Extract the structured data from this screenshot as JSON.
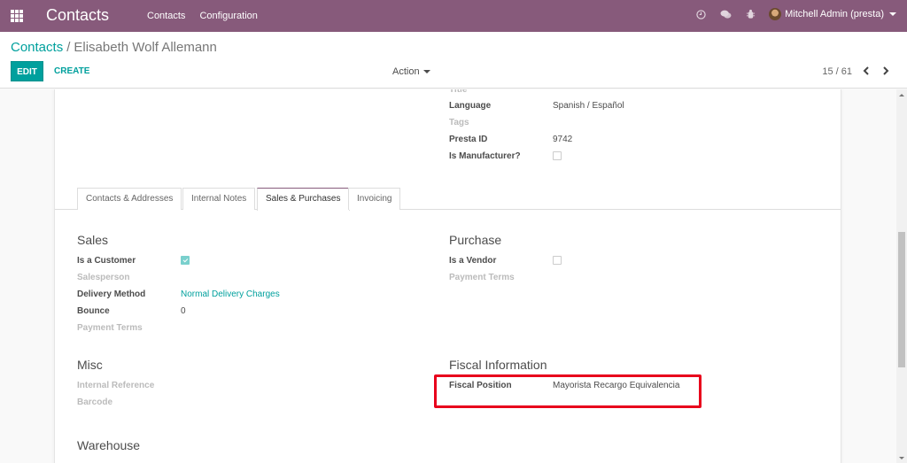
{
  "navbar": {
    "app_title": "Contacts",
    "menu": [
      "Contacts",
      "Configuration"
    ],
    "user": "Mitchell Admin (presta)",
    "icons": [
      "clock-icon",
      "chat-icon",
      "bug-icon"
    ]
  },
  "control_panel": {
    "breadcrumb_parent": "Contacts",
    "breadcrumb_separator": "/",
    "breadcrumb_current": "Elisabeth Wolf Allemann",
    "edit_label": "EDIT",
    "create_label": "CREATE",
    "action_label": "Action",
    "pager": "15 / 61"
  },
  "top_fields": {
    "title_label": "Title",
    "language_label": "Language",
    "language_value": "Spanish / Español",
    "tags_label": "Tags",
    "presta_id_label": "Presta ID",
    "presta_id_value": "9742",
    "is_manufacturer_label": "Is Manufacturer?",
    "is_manufacturer_checked": false
  },
  "tabs": [
    {
      "label": "Contacts & Addresses",
      "active": false
    },
    {
      "label": "Internal Notes",
      "active": false
    },
    {
      "label": "Sales & Purchases",
      "active": true
    },
    {
      "label": "Invoicing",
      "active": false
    }
  ],
  "sales": {
    "title": "Sales",
    "is_customer_label": "Is a Customer",
    "is_customer_checked": true,
    "salesperson_label": "Salesperson",
    "delivery_method_label": "Delivery Method",
    "delivery_method_value": "Normal Delivery Charges",
    "bounce_label": "Bounce",
    "bounce_value": "0",
    "payment_terms_label": "Payment Terms"
  },
  "purchase": {
    "title": "Purchase",
    "is_vendor_label": "Is a Vendor",
    "is_vendor_checked": false,
    "payment_terms_label": "Payment Terms"
  },
  "misc": {
    "title": "Misc",
    "internal_reference_label": "Internal Reference",
    "barcode_label": "Barcode"
  },
  "fiscal": {
    "title": "Fiscal Information",
    "fiscal_position_label": "Fiscal Position",
    "fiscal_position_value": "Mayorista Recargo Equivalencia"
  },
  "warehouse": {
    "title": "Warehouse"
  },
  "colors": {
    "brand": "#875a7b",
    "accent": "#00a09d",
    "highlight": "#e8001c"
  }
}
